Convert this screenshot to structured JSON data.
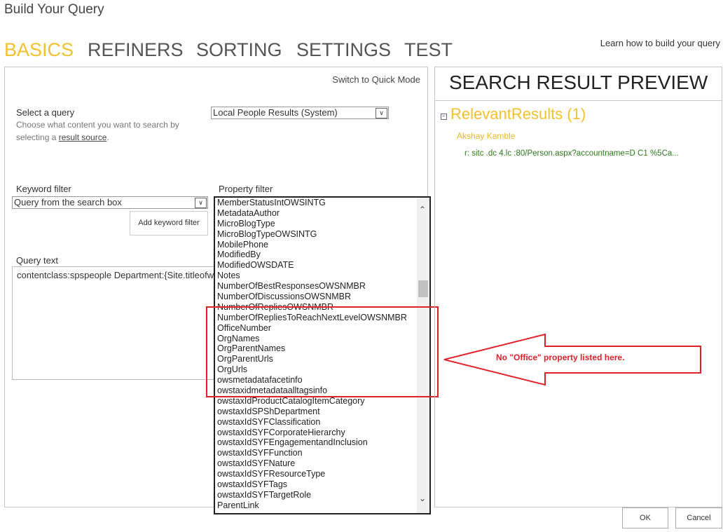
{
  "dialog_title": "Build Your Query",
  "tabs": [
    {
      "label": "BASICS",
      "active": true
    },
    {
      "label": "REFINERS"
    },
    {
      "label": "SORTING"
    },
    {
      "label": "SETTINGS"
    },
    {
      "label": "TEST"
    }
  ],
  "learn_link": "Learn how to build your query",
  "basics": {
    "quick_mode": "Switch to Quick Mode",
    "select_query_label": "Select a query",
    "select_query_hint_1": "Choose what content you want to search by selecting a ",
    "select_query_hint_link": "result source",
    "select_query_hint_end": ".",
    "select_query_value": "Local People Results (System)",
    "keyword_filter_label": "Keyword filter",
    "keyword_filter_value": "Query from the search box",
    "add_keyword_filter": "Add keyword filter",
    "property_filter_label": "Property filter",
    "property_items": [
      "MemberStatusIntOWSINTG",
      "MetadataAuthor",
      "MicroBlogType",
      "MicroBlogTypeOWSINTG",
      "MobilePhone",
      "ModifiedBy",
      "ModifiedOWSDATE",
      "Notes",
      "NumberOfBestResponsesOWSNMBR",
      "NumberOfDiscussionsOWSNMBR",
      "NumberOfRepliesOWSNMBR",
      "NumberOfRepliesToReachNextLevelOWSNMBR",
      "OfficeNumber",
      "OrgNames",
      "OrgParentNames",
      "OrgParentUrls",
      "OrgUrls",
      "owsmetadatafacetinfo",
      "owstaxidmetadataalltagsinfo",
      "owstaxIdProductCatalogItemCategory",
      "owstaxIdSPShDepartment",
      "owstaxIdSYFClassification",
      "owstaxIdSYFCorporateHierarchy",
      "owstaxIdSYFEngagementandInclusion",
      "owstaxIdSYFFunction",
      "owstaxIdSYFNature",
      "owstaxIdSYFResourceType",
      "owstaxIdSYFTags",
      "owstaxIdSYFTargetRole",
      "ParentLink"
    ],
    "query_text_label": "Query text",
    "query_text_value": "contentclass:spspeople Department:{Site.titleofw"
  },
  "preview": {
    "title": "SEARCH RESULT PREVIEW",
    "group": "RelevantResults (1)",
    "person": "Akshay Kamble",
    "url": "r: sitc .dc 4.lc :80/Person.aspx?accountname=D C1 %5Ca..."
  },
  "annotation": {
    "text": "No \"Office\" property listed here.",
    "color": "#e0202a"
  },
  "buttons": {
    "ok": "OK",
    "cancel": "Cancel"
  },
  "colors": {
    "active_tab": "#f2c12e",
    "result_title": "#f2c12e",
    "url": "#2a7a1a"
  }
}
